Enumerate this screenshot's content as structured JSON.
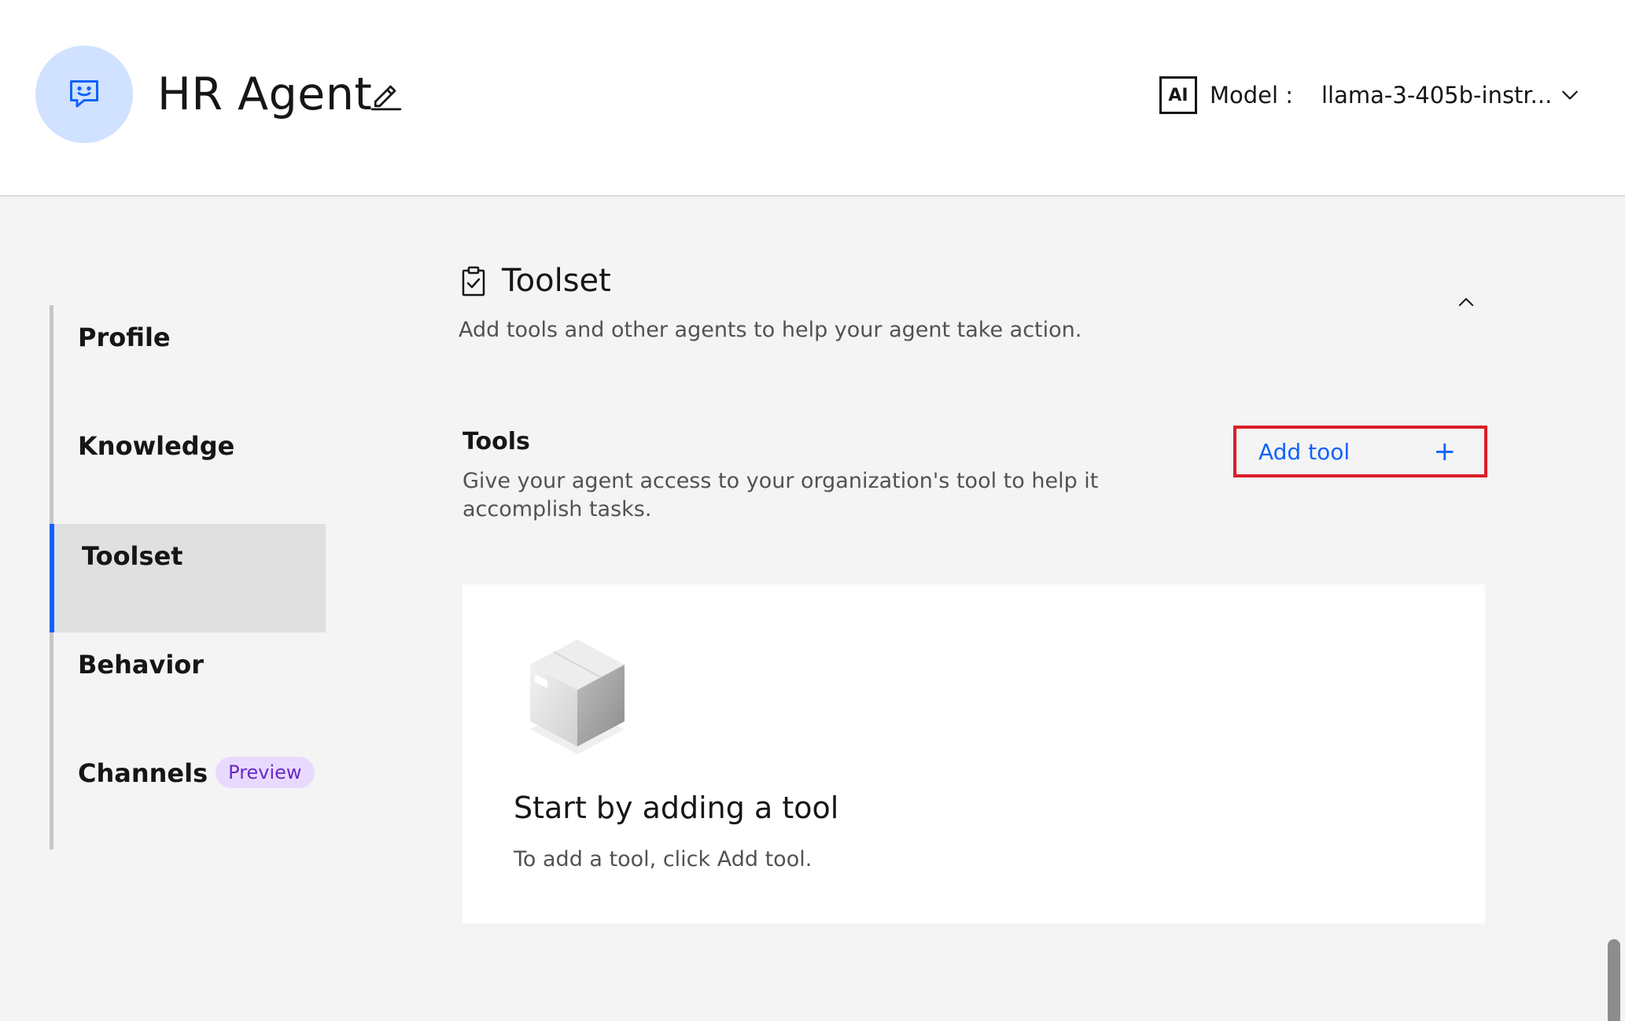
{
  "header": {
    "agent_name": "HR Agent",
    "model_badge": "AI",
    "model_label": "Model :",
    "model_value": "llama-3-405b-instr..."
  },
  "sidebar": {
    "items": [
      {
        "label": "Profile"
      },
      {
        "label": "Knowledge"
      },
      {
        "label": "Toolset",
        "active": true
      },
      {
        "label": "Behavior"
      },
      {
        "label": "Channels",
        "badge": "Preview"
      }
    ]
  },
  "section": {
    "title": "Toolset",
    "description": "Add tools and other agents to help your agent take action."
  },
  "tools": {
    "title": "Tools",
    "description": "Give your agent access to your organization's tool to help it accomplish tasks.",
    "add_button_label": "Add tool",
    "add_button_icon": "+"
  },
  "empty_state": {
    "title": "Start by adding a tool",
    "description": "To add a tool, click Add tool."
  },
  "colors": {
    "accent": "#0f62fe",
    "avatar_bg": "#d0e2ff",
    "highlight_border": "#da1e28",
    "preview_badge_bg": "#e8daff",
    "preview_badge_text": "#6929c4"
  }
}
